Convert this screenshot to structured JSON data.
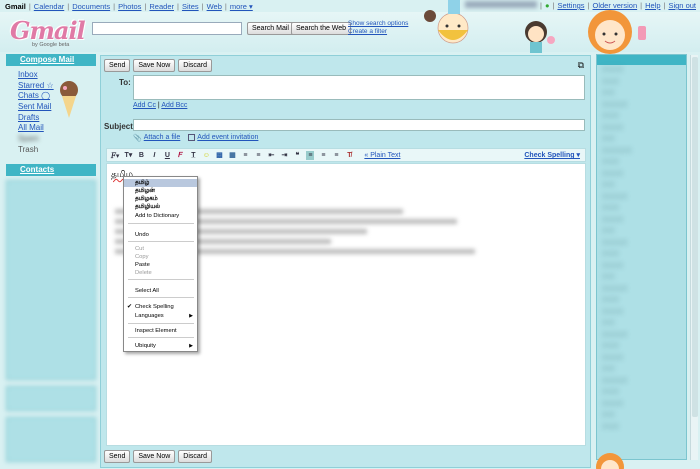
{
  "topnav": {
    "app": "Gmail",
    "links": [
      "Calendar",
      "Documents",
      "Photos",
      "Reader",
      "Sites",
      "Web",
      "more ▾"
    ],
    "right_links": [
      "Settings",
      "Older version",
      "Help",
      "Sign out"
    ]
  },
  "header": {
    "logo_text": "Gmail",
    "logo_sub": "by Google  beta",
    "search_value": "",
    "search_mail_label": "Search Mail",
    "search_web_label": "Search the Web",
    "show_options_label": "Show search options",
    "create_filter_label": "Create a filter"
  },
  "sidebar": {
    "compose_label": "Compose Mail",
    "items": [
      {
        "label": "Inbox"
      },
      {
        "label": "Starred ☆"
      },
      {
        "label": "Chats ◯"
      },
      {
        "label": "Sent Mail"
      },
      {
        "label": "Drafts"
      },
      {
        "label": "All Mail"
      },
      {
        "label": "Spam"
      },
      {
        "label": "Trash"
      }
    ],
    "contacts_label": "Contacts"
  },
  "compose": {
    "send_label": "Send",
    "save_label": "Save Now",
    "discard_label": "Discard",
    "to_label": "To:",
    "to_value": "",
    "add_cc_label": "Add Cc",
    "add_bcc_label": "Add Bcc",
    "subject_label": "Subject:",
    "subject_value": "",
    "attach_label": "Attach a file",
    "event_label": "Add event invitation",
    "plain_text_label": "« Plain Text",
    "spell_label": "Check Spelling ▾",
    "body_text": "தமிழ"
  },
  "context_menu": {
    "suggestions": [
      "தமிழ்",
      "தமிழன்",
      "தமிழகம்",
      "தமிழியல்"
    ],
    "add_dictionary": "Add to Dictionary",
    "undo": "Undo",
    "cut": "Cut",
    "copy": "Copy",
    "paste": "Paste",
    "delete": "Delete",
    "select_all": "Select All",
    "check_spelling": "Check Spelling",
    "languages": "Languages",
    "inspect": "Inspect Element",
    "ubiquity": "Ubiquity"
  },
  "colors": {
    "accent": "#3fb5c5",
    "page_bg": "#d9f1f2",
    "panel_bg": "#bfe7ec",
    "link": "#2255bb"
  }
}
